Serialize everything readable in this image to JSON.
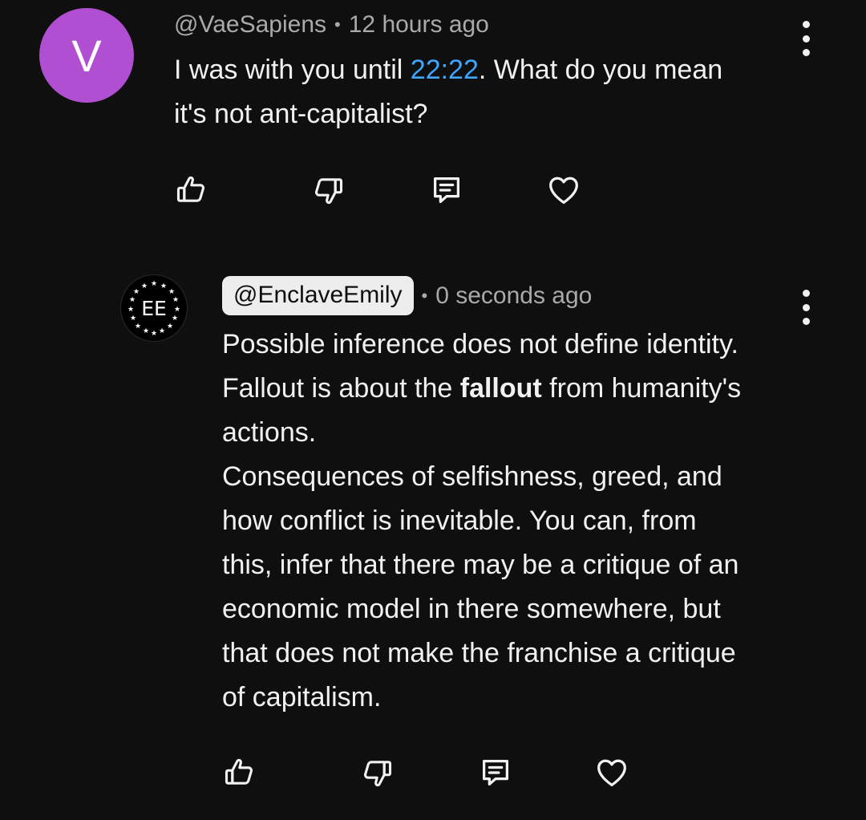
{
  "comment1": {
    "avatar_letter": "V",
    "handle": "@VaeSapiens",
    "separator": "•",
    "time": "12 hours ago",
    "text_before": "I was with you until ",
    "timestamp": "22:22",
    "text_after_line1": ". What do you mean",
    "text_line2": "it's not ant-capitalist?",
    "avatar_color": "#b04fd1"
  },
  "comment2": {
    "avatar_text": "EE",
    "handle": "@EnclaveEmily",
    "separator": "•",
    "time": "0 seconds ago",
    "line1": "Possible inference does not define identity.",
    "line2_before": "Fallout is about the ",
    "line2_bold": "fallout",
    "line2_after": " from humanity's",
    "line3": "actions.",
    "line4": "Consequences of selfishness, greed, and",
    "line5": "how conflict is inevitable. You can, from",
    "line6": "this, infer that there may be a critique of an",
    "line7": "economic model in there somewhere, but",
    "line8": "that does not make the franchise a critique",
    "line9": "of capitalism."
  },
  "icons": {
    "like": "thumbs-up-icon",
    "dislike": "thumbs-down-icon",
    "reply": "reply-icon",
    "heart": "heart-icon",
    "more": "more-vertical-icon"
  },
  "colors": {
    "background": "#0f0f0f",
    "link": "#3ea6ff",
    "meta": "#aaaaaa"
  }
}
